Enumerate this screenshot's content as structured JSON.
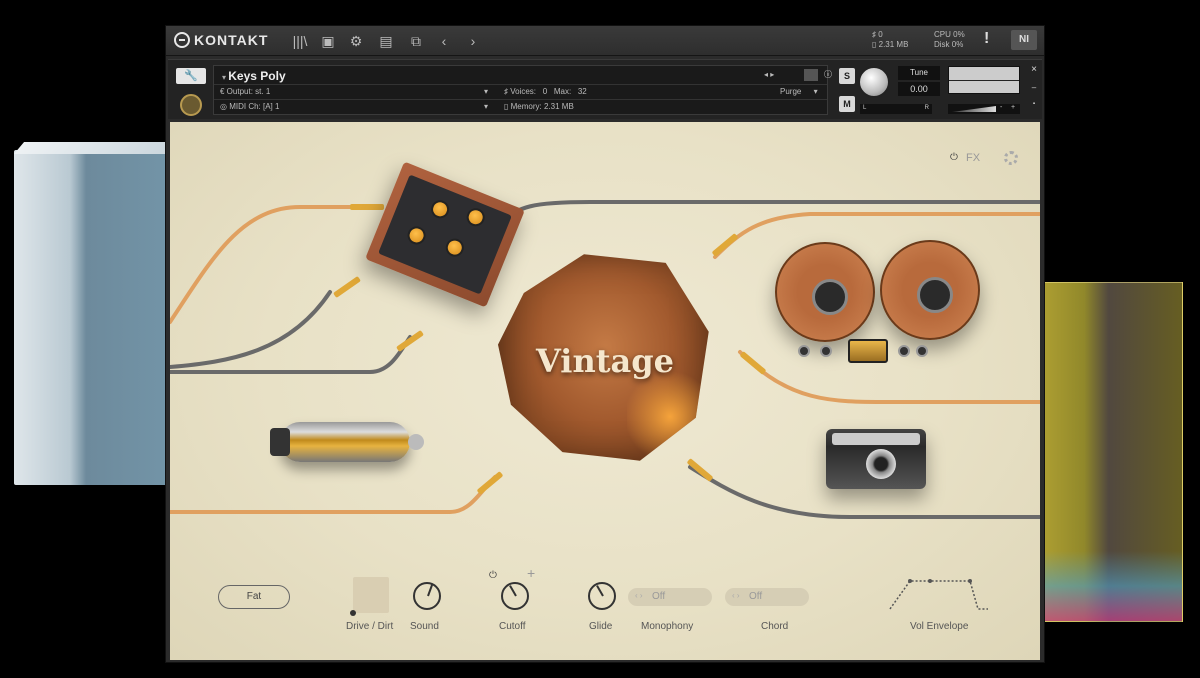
{
  "topbar": {
    "brand": "KONTAKT",
    "stats": {
      "voices_count": "0",
      "memory": "2.31 MB",
      "cpu_label": "CPU",
      "cpu_value": "0%",
      "disk_label": "Disk",
      "disk_value": "0%"
    },
    "warning_glyph": "!",
    "icons": [
      "library-icon",
      "save-icon",
      "settings-icon",
      "view-icon",
      "resize-icon",
      "prev-icon",
      "next-icon"
    ]
  },
  "instrument": {
    "name": "Keys Poly",
    "output_label": "Output:",
    "output_value": "st. 1",
    "midi_label": "MIDI Ch:",
    "midi_value": "[A] 1",
    "voices_label": "Voices:",
    "voices_value": "0",
    "max_label": "Max:",
    "max_value": "32",
    "memory_label": "Memory:",
    "memory_value": "2.31 MB",
    "purge_label": "Purge",
    "solo_label": "S",
    "mute_label": "M",
    "tune_label": "Tune",
    "tune_value": "0.00",
    "pan_left": "L",
    "pan_right": "R",
    "vol_minus": "-",
    "vol_plus": "+",
    "close_glyph": "×"
  },
  "panel": {
    "title": "Vintage",
    "fx_label": "FX",
    "controls": {
      "fat_label": "Fat",
      "drive_label": "Drive / Dirt",
      "sound_label": "Sound",
      "cutoff_label": "Cutoff",
      "cutoff_plus": "+",
      "glide_label": "Glide",
      "monophony_label": "Monophony",
      "monophony_value": "Off",
      "chord_label": "Chord",
      "chord_value": "Off",
      "vol_envelope_label": "Vol Envelope"
    }
  },
  "colors": {
    "panel_bg": "#e8e1c6",
    "cable_orange": "#e0a060",
    "cable_gray": "#6a6a6a",
    "accent_gold": "#e0a838"
  }
}
